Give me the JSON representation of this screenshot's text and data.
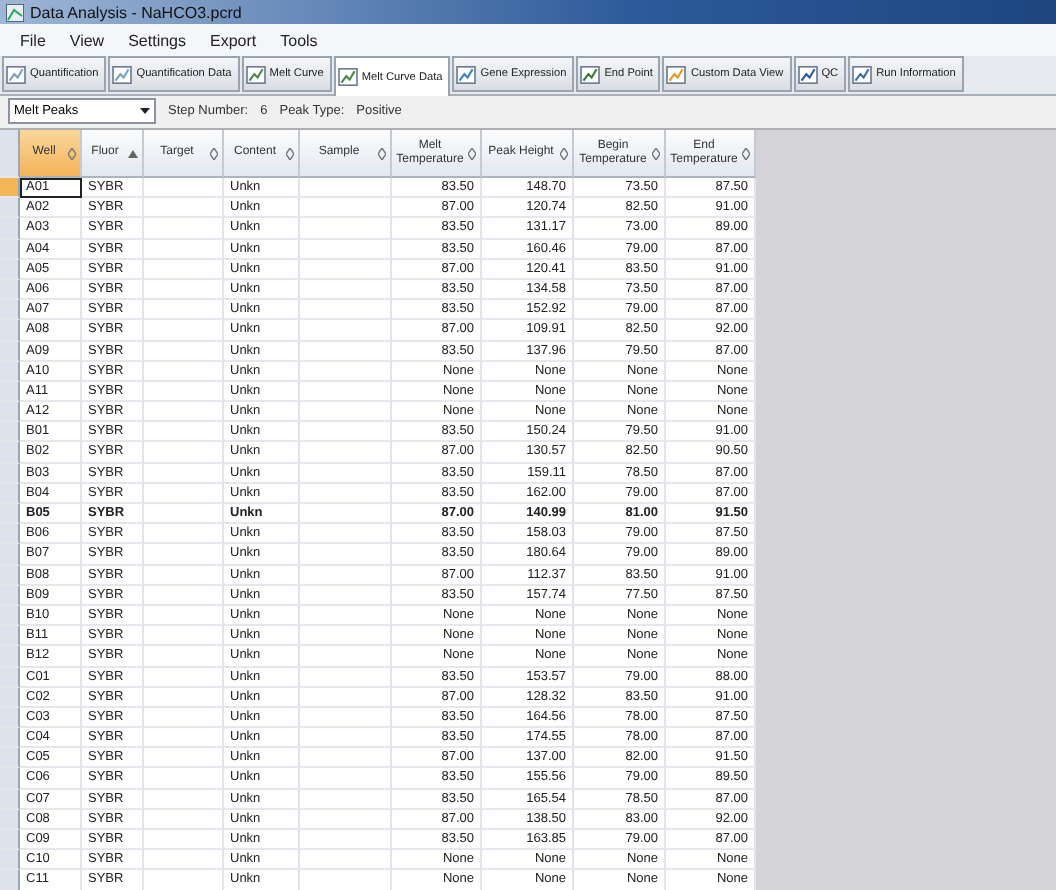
{
  "window": {
    "title": "Data Analysis - NaHCO3.pcrd"
  },
  "menu": [
    "File",
    "View",
    "Settings",
    "Export",
    "Tools"
  ],
  "tabs": [
    {
      "label": "Quantification",
      "selected": false
    },
    {
      "label": "Quantification Data",
      "selected": false
    },
    {
      "label": "Melt Curve",
      "selected": false
    },
    {
      "label": "Melt Curve Data",
      "selected": true
    },
    {
      "label": "Gene Expression",
      "selected": false
    },
    {
      "label": "End Point",
      "selected": false
    },
    {
      "label": "Custom Data View",
      "selected": false
    },
    {
      "label": "QC",
      "selected": false
    },
    {
      "label": "Run Information",
      "selected": false
    }
  ],
  "filter": {
    "dropdown": "Melt Peaks",
    "step_label": "Step Number:",
    "step_value": "6",
    "peak_label": "Peak Type:",
    "peak_value": "Positive"
  },
  "table": {
    "columns": [
      {
        "label": "Well",
        "selected": true,
        "sorted": false
      },
      {
        "label": "Fluor",
        "selected": false,
        "sorted": true
      },
      {
        "label": "Target",
        "selected": false,
        "sorted": false
      },
      {
        "label": "Content",
        "selected": false,
        "sorted": false
      },
      {
        "label": "Sample",
        "selected": false,
        "sorted": false
      },
      {
        "label": "Melt Temperature",
        "selected": false,
        "sorted": false
      },
      {
        "label": "Peak Height",
        "selected": false,
        "sorted": false
      },
      {
        "label": "Begin Temperature",
        "selected": false,
        "sorted": false
      },
      {
        "label": "End Temperature",
        "selected": false,
        "sorted": false
      }
    ],
    "rows": [
      {
        "current": true,
        "selected": false,
        "well": "A01",
        "fluor": "SYBR",
        "content": "Unkn",
        "values": [
          "83.50",
          "148.70",
          "73.50",
          "87.50"
        ]
      },
      {
        "current": false,
        "selected": false,
        "well": "A02",
        "fluor": "SYBR",
        "content": "Unkn",
        "values": [
          "87.00",
          "120.74",
          "82.50",
          "91.00"
        ]
      },
      {
        "current": false,
        "selected": false,
        "well": "A03",
        "fluor": "SYBR",
        "content": "Unkn",
        "values": [
          "83.50",
          "131.17",
          "73.00",
          "89.00"
        ]
      },
      {
        "current": false,
        "selected": false,
        "well": "A04",
        "fluor": "SYBR",
        "content": "Unkn",
        "values": [
          "83.50",
          "160.46",
          "79.00",
          "87.00"
        ]
      },
      {
        "current": false,
        "selected": false,
        "well": "A05",
        "fluor": "SYBR",
        "content": "Unkn",
        "values": [
          "87.00",
          "120.41",
          "83.50",
          "91.00"
        ]
      },
      {
        "current": false,
        "selected": false,
        "well": "A06",
        "fluor": "SYBR",
        "content": "Unkn",
        "values": [
          "83.50",
          "134.58",
          "73.50",
          "87.00"
        ]
      },
      {
        "current": false,
        "selected": false,
        "well": "A07",
        "fluor": "SYBR",
        "content": "Unkn",
        "values": [
          "83.50",
          "152.92",
          "79.00",
          "87.00"
        ]
      },
      {
        "current": false,
        "selected": false,
        "well": "A08",
        "fluor": "SYBR",
        "content": "Unkn",
        "values": [
          "87.00",
          "109.91",
          "82.50",
          "92.00"
        ]
      },
      {
        "current": false,
        "selected": false,
        "well": "A09",
        "fluor": "SYBR",
        "content": "Unkn",
        "values": [
          "83.50",
          "137.96",
          "79.50",
          "87.00"
        ]
      },
      {
        "current": false,
        "selected": false,
        "well": "A10",
        "fluor": "SYBR",
        "content": "Unkn",
        "values": [
          "None",
          "None",
          "None",
          "None"
        ]
      },
      {
        "current": false,
        "selected": false,
        "well": "A11",
        "fluor": "SYBR",
        "content": "Unkn",
        "values": [
          "None",
          "None",
          "None",
          "None"
        ]
      },
      {
        "current": false,
        "selected": false,
        "well": "A12",
        "fluor": "SYBR",
        "content": "Unkn",
        "values": [
          "None",
          "None",
          "None",
          "None"
        ]
      },
      {
        "current": false,
        "selected": false,
        "well": "B01",
        "fluor": "SYBR",
        "content": "Unkn",
        "values": [
          "83.50",
          "150.24",
          "79.50",
          "91.00"
        ]
      },
      {
        "current": false,
        "selected": false,
        "well": "B02",
        "fluor": "SYBR",
        "content": "Unkn",
        "values": [
          "87.00",
          "130.57",
          "82.50",
          "90.50"
        ]
      },
      {
        "current": false,
        "selected": false,
        "well": "B03",
        "fluor": "SYBR",
        "content": "Unkn",
        "values": [
          "83.50",
          "159.11",
          "78.50",
          "87.00"
        ]
      },
      {
        "current": false,
        "selected": false,
        "well": "B04",
        "fluor": "SYBR",
        "content": "Unkn",
        "values": [
          "83.50",
          "162.00",
          "79.00",
          "87.00"
        ]
      },
      {
        "current": false,
        "selected": true,
        "well": "B05",
        "fluor": "SYBR",
        "content": "Unkn",
        "values": [
          "87.00",
          "140.99",
          "81.00",
          "91.50"
        ]
      },
      {
        "current": false,
        "selected": false,
        "well": "B06",
        "fluor": "SYBR",
        "content": "Unkn",
        "values": [
          "83.50",
          "158.03",
          "79.00",
          "87.50"
        ]
      },
      {
        "current": false,
        "selected": false,
        "well": "B07",
        "fluor": "SYBR",
        "content": "Unkn",
        "values": [
          "83.50",
          "180.64",
          "79.00",
          "89.00"
        ]
      },
      {
        "current": false,
        "selected": false,
        "well": "B08",
        "fluor": "SYBR",
        "content": "Unkn",
        "values": [
          "87.00",
          "112.37",
          "83.50",
          "91.00"
        ]
      },
      {
        "current": false,
        "selected": false,
        "well": "B09",
        "fluor": "SYBR",
        "content": "Unkn",
        "values": [
          "83.50",
          "157.74",
          "77.50",
          "87.50"
        ]
      },
      {
        "current": false,
        "selected": false,
        "well": "B10",
        "fluor": "SYBR",
        "content": "Unkn",
        "values": [
          "None",
          "None",
          "None",
          "None"
        ]
      },
      {
        "current": false,
        "selected": false,
        "well": "B11",
        "fluor": "SYBR",
        "content": "Unkn",
        "values": [
          "None",
          "None",
          "None",
          "None"
        ]
      },
      {
        "current": false,
        "selected": false,
        "well": "B12",
        "fluor": "SYBR",
        "content": "Unkn",
        "values": [
          "None",
          "None",
          "None",
          "None"
        ]
      },
      {
        "current": false,
        "selected": false,
        "well": "C01",
        "fluor": "SYBR",
        "content": "Unkn",
        "values": [
          "83.50",
          "153.57",
          "79.00",
          "88.00"
        ]
      },
      {
        "current": false,
        "selected": false,
        "well": "C02",
        "fluor": "SYBR",
        "content": "Unkn",
        "values": [
          "87.00",
          "128.32",
          "83.50",
          "91.00"
        ]
      },
      {
        "current": false,
        "selected": false,
        "well": "C03",
        "fluor": "SYBR",
        "content": "Unkn",
        "values": [
          "83.50",
          "164.56",
          "78.00",
          "87.50"
        ]
      },
      {
        "current": false,
        "selected": false,
        "well": "C04",
        "fluor": "SYBR",
        "content": "Unkn",
        "values": [
          "83.50",
          "174.55",
          "78.00",
          "87.00"
        ]
      },
      {
        "current": false,
        "selected": false,
        "well": "C05",
        "fluor": "SYBR",
        "content": "Unkn",
        "values": [
          "87.00",
          "137.00",
          "82.00",
          "91.50"
        ]
      },
      {
        "current": false,
        "selected": false,
        "well": "C06",
        "fluor": "SYBR",
        "content": "Unkn",
        "values": [
          "83.50",
          "155.56",
          "79.00",
          "89.50"
        ]
      },
      {
        "current": false,
        "selected": false,
        "well": "C07",
        "fluor": "SYBR",
        "content": "Unkn",
        "values": [
          "83.50",
          "165.54",
          "78.50",
          "87.00"
        ]
      },
      {
        "current": false,
        "selected": false,
        "well": "C08",
        "fluor": "SYBR",
        "content": "Unkn",
        "values": [
          "87.00",
          "138.50",
          "83.00",
          "92.00"
        ]
      },
      {
        "current": false,
        "selected": false,
        "well": "C09",
        "fluor": "SYBR",
        "content": "Unkn",
        "values": [
          "83.50",
          "163.85",
          "79.00",
          "87.00"
        ]
      },
      {
        "current": false,
        "selected": false,
        "well": "C10",
        "fluor": "SYBR",
        "content": "Unkn",
        "values": [
          "None",
          "None",
          "None",
          "None"
        ]
      },
      {
        "current": false,
        "selected": false,
        "well": "C11",
        "fluor": "SYBR",
        "content": "Unkn",
        "values": [
          "None",
          "None",
          "None",
          "None"
        ]
      }
    ]
  }
}
